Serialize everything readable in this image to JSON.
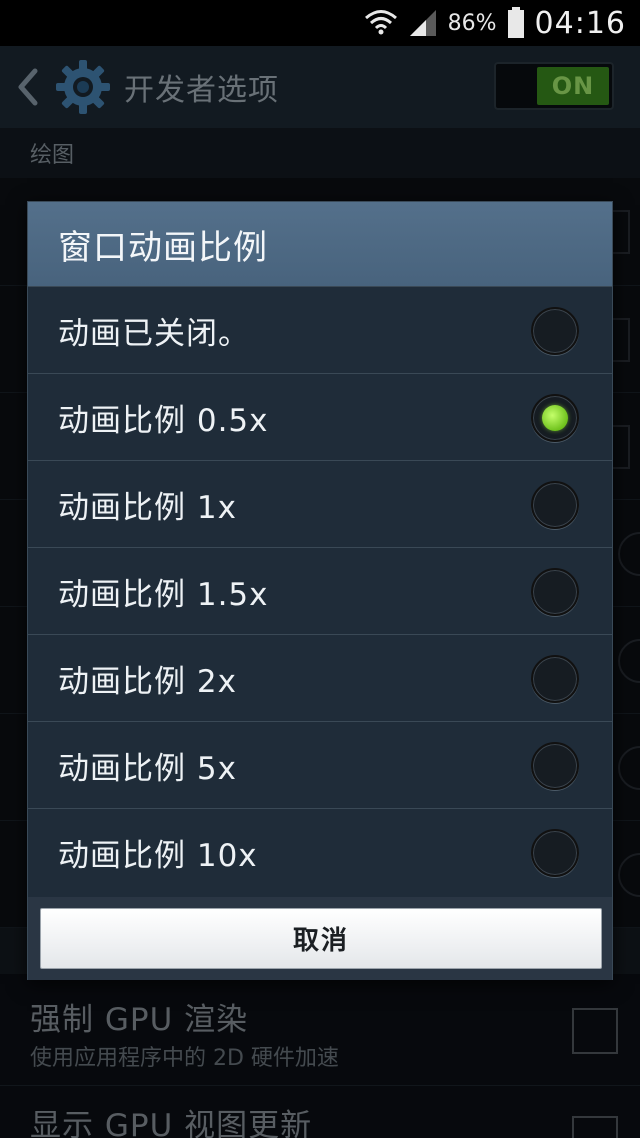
{
  "status_bar": {
    "battery_percent": "86%",
    "time": "04:16",
    "icons": [
      "wifi-icon",
      "signal-icon",
      "battery-icon"
    ]
  },
  "action_bar": {
    "title": "开发者选项",
    "toggle_label": "ON",
    "icons": [
      "back-arrow-icon",
      "gear-icon"
    ]
  },
  "background": {
    "section_header": "绘图",
    "settings": [
      {
        "title": "强制 GPU 渲染",
        "subtitle": "使用应用程序中的 2D 硬件加速"
      },
      {
        "title": "显示 GPU 视图更新",
        "subtitle": ""
      }
    ]
  },
  "dialog": {
    "title": "窗口动画比例",
    "options": [
      {
        "label": "动画已关闭。",
        "selected": false
      },
      {
        "label": "动画比例 0.5x",
        "selected": true
      },
      {
        "label": "动画比例 1x",
        "selected": false
      },
      {
        "label": "动画比例 1.5x",
        "selected": false
      },
      {
        "label": "动画比例 2x",
        "selected": false
      },
      {
        "label": "动画比例 5x",
        "selected": false
      },
      {
        "label": "动画比例 10x",
        "selected": false
      }
    ],
    "cancel_label": "取消"
  },
  "colors": {
    "accent_green": "#6fc21d",
    "dialog_header": "#4e6a85",
    "toggle_on": "#3c8f1f"
  }
}
